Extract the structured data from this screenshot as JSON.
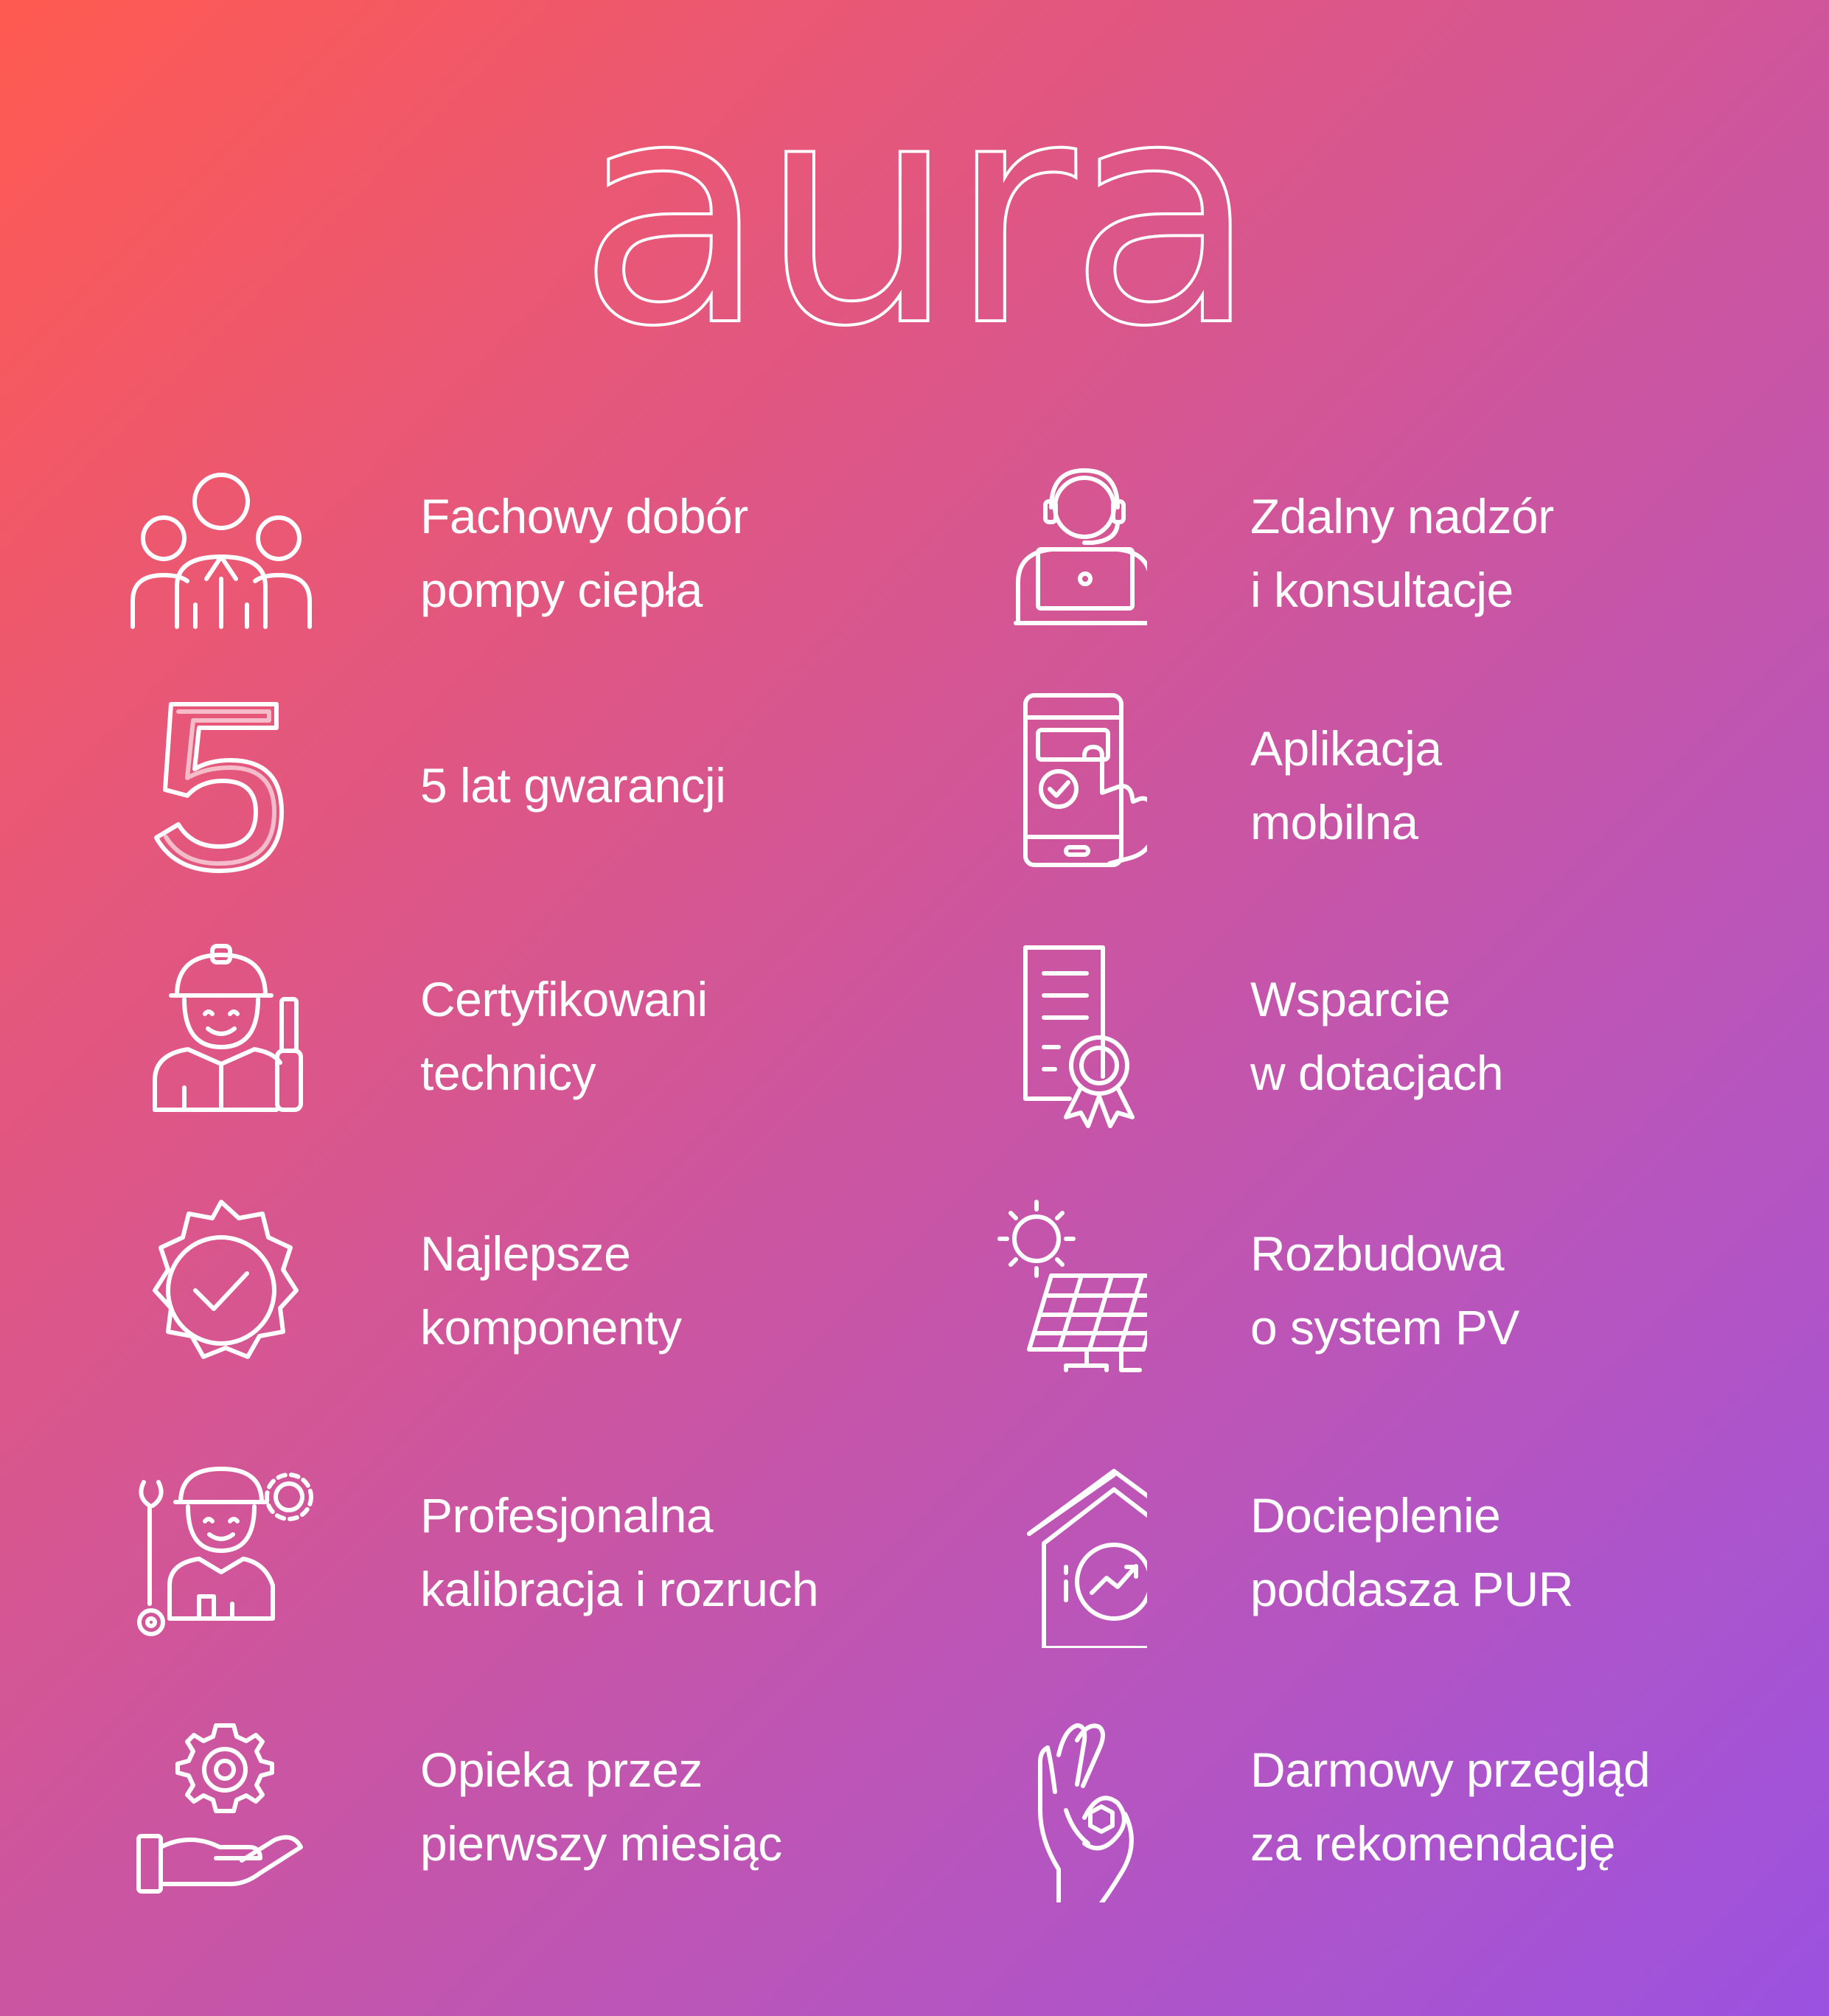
{
  "brand": {
    "logo_text": "aura"
  },
  "features_left": [
    {
      "icon": "team-icon",
      "line1": "Fachowy dobór",
      "line2": "pompy ciepła"
    },
    {
      "icon": "number-five-icon",
      "line1": "5 lat gwarancji",
      "line2": ""
    },
    {
      "icon": "technician-icon",
      "line1": "Certyfikowani",
      "line2": "technicy"
    },
    {
      "icon": "quality-badge-icon",
      "line1": "Najlepsze",
      "line2": "komponenty"
    },
    {
      "icon": "engineer-tools-icon",
      "line1": "Profesjonalna",
      "line2": "kalibracja i rozruch"
    },
    {
      "icon": "gear-hand-icon",
      "line1": "Opieka przez",
      "line2": "pierwszy miesiąc"
    }
  ],
  "features_right": [
    {
      "icon": "remote-support-icon",
      "line1": "Zdalny nadzór",
      "line2": "i konsultacje"
    },
    {
      "icon": "mobile-app-icon",
      "line1": "Aplikacja",
      "line2": "mobilna"
    },
    {
      "icon": "certificate-icon",
      "line1": "Wsparcie",
      "line2": "w dotacjach"
    },
    {
      "icon": "solar-panel-icon",
      "line1": "Rozbudowa",
      "line2": "o system PV"
    },
    {
      "icon": "house-insulation-icon",
      "line1": "Docieplenie",
      "line2": "poddasza PUR"
    },
    {
      "icon": "ok-hand-icon",
      "line1": "Darmowy przegląd",
      "line2": "za rekomendację"
    }
  ],
  "colors": {
    "gradient_start": "#ff5a50",
    "gradient_end": "#9b52e0",
    "foreground": "#ffffff"
  }
}
